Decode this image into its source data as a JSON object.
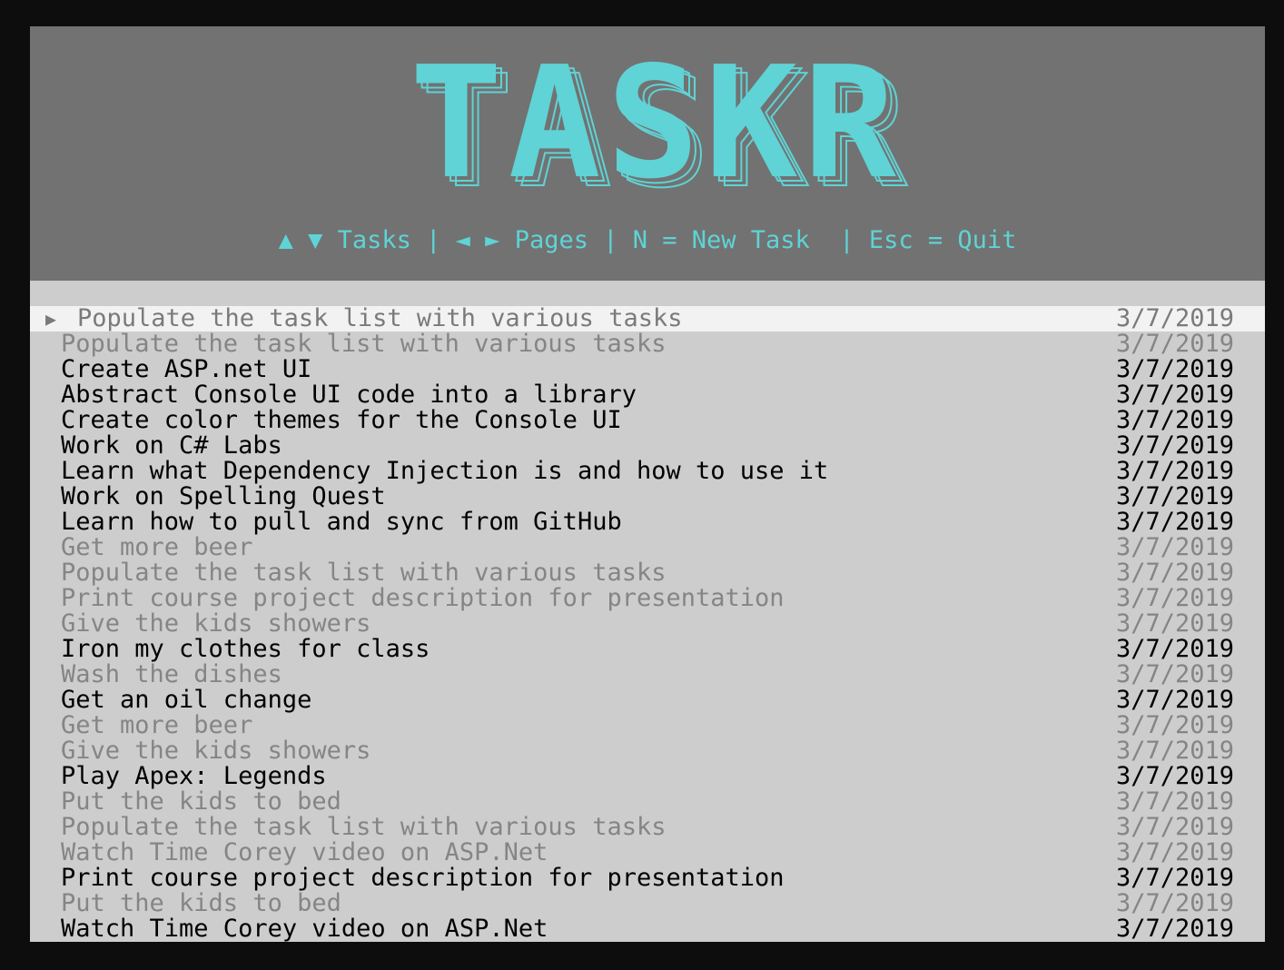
{
  "app": {
    "logo_text": "TASKR",
    "colors": {
      "accent": "#5fd3d5",
      "header_bg": "#727272",
      "list_bg": "#cdcdcd",
      "selected_bg": "#f2f2f2",
      "active_text": "#000000",
      "done_text": "#858585"
    }
  },
  "hints": {
    "text": "▲ ▼ Tasks | ◄ ► Pages | N = New Task  | Esc = Quit"
  },
  "tasks": [
    {
      "title": "Populate the task list with various tasks",
      "date": "3/7/2019",
      "state": "selected",
      "marker": "▶"
    },
    {
      "title": "Populate the task list with various tasks",
      "date": "3/7/2019",
      "state": "done"
    },
    {
      "title": "Create ASP.net UI",
      "date": "3/7/2019",
      "state": "active"
    },
    {
      "title": "Abstract Console UI code into a library",
      "date": "3/7/2019",
      "state": "active"
    },
    {
      "title": "Create color themes for the Console UI",
      "date": "3/7/2019",
      "state": "active"
    },
    {
      "title": "Work on C# Labs",
      "date": "3/7/2019",
      "state": "active"
    },
    {
      "title": "Learn what Dependency Injection is and how to use it",
      "date": "3/7/2019",
      "state": "active"
    },
    {
      "title": "Work on Spelling Quest",
      "date": "3/7/2019",
      "state": "active"
    },
    {
      "title": "Learn how to pull and sync from GitHub",
      "date": "3/7/2019",
      "state": "active"
    },
    {
      "title": "Get more beer",
      "date": "3/7/2019",
      "state": "done"
    },
    {
      "title": "Populate the task list with various tasks",
      "date": "3/7/2019",
      "state": "done"
    },
    {
      "title": "Print course project description for presentation",
      "date": "3/7/2019",
      "state": "done"
    },
    {
      "title": "Give the kids showers",
      "date": "3/7/2019",
      "state": "done"
    },
    {
      "title": "Iron my clothes for class",
      "date": "3/7/2019",
      "state": "active"
    },
    {
      "title": "Wash the dishes",
      "date": "3/7/2019",
      "state": "done"
    },
    {
      "title": "Get an oil change",
      "date": "3/7/2019",
      "state": "active"
    },
    {
      "title": "Get more beer",
      "date": "3/7/2019",
      "state": "done"
    },
    {
      "title": "Give the kids showers",
      "date": "3/7/2019",
      "state": "done"
    },
    {
      "title": "Play Apex: Legends",
      "date": "3/7/2019",
      "state": "active"
    },
    {
      "title": "Put the kids to bed",
      "date": "3/7/2019",
      "state": "done"
    },
    {
      "title": "Populate the task list with various tasks",
      "date": "3/7/2019",
      "state": "done"
    },
    {
      "title": "Watch Time Corey video on ASP.Net",
      "date": "3/7/2019",
      "state": "done"
    },
    {
      "title": "Print course project description for presentation",
      "date": "3/7/2019",
      "state": "active"
    },
    {
      "title": "Put the kids to bed",
      "date": "3/7/2019",
      "state": "done"
    },
    {
      "title": "Watch Time Corey video on ASP.Net",
      "date": "3/7/2019",
      "state": "active"
    }
  ]
}
